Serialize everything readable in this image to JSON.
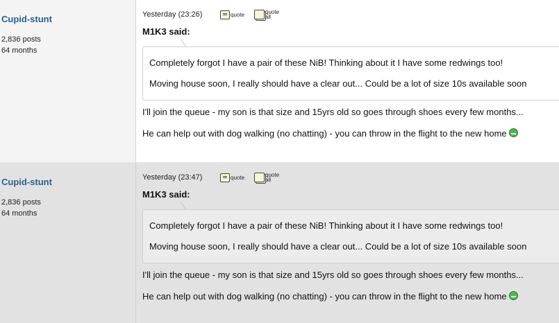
{
  "posts": [
    {
      "author": "Cupid-stunt",
      "posts_count": "2,836 posts",
      "tenure": "64 months",
      "date": "Yesterday (23:26)",
      "quote_label": "quote",
      "quote_all_label_1": "quote",
      "quote_all_label_2": "all",
      "quoted_user": "M1K3 said:",
      "quote_lines": [
        "Completely forgot I have a pair of these NiB! Thinking about it I have some redwings too!",
        "Moving house soon, I really should have a clear out... Could be a lot of size 10s available soon"
      ],
      "body_lines": [
        "I'll join the queue - my son is that size and 15yrs old so goes through shoes every few months...",
        "He can help out with dog walking (no chatting) - you can throw in the flight to the new home"
      ],
      "smiley_icon": "smiley-icon"
    },
    {
      "author": "Cupid-stunt",
      "posts_count": "2,836 posts",
      "tenure": "64 months",
      "date": "Yesterday (23:47)",
      "quote_label": "quote",
      "quote_all_label_1": "quote",
      "quote_all_label_2": "all",
      "quoted_user": "M1K3 said:",
      "quote_lines": [
        "Completely forgot I have a pair of these NiB! Thinking about it I have some redwings too!",
        "Moving house soon, I really should have a clear out... Could be a lot of size 10s available soon"
      ],
      "body_lines": [
        "I'll join the queue - my son is that size and 15yrs old so goes through shoes every few months...",
        "He can help out with dog walking (no chatting) - you can throw in the flight to the new home"
      ],
      "smiley_icon": "smiley-icon"
    }
  ],
  "colors": {
    "username": "#2a5f92",
    "author_bg": "#f4f4f4",
    "alt_bg": "#e2e2e2"
  }
}
